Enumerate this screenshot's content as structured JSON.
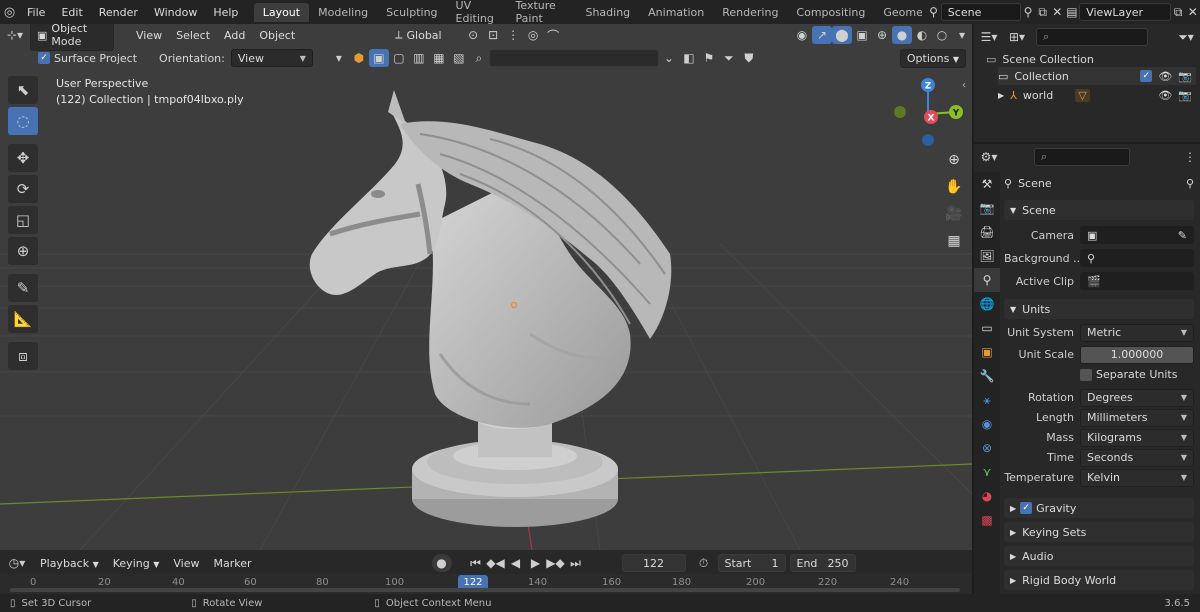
{
  "topbar": {
    "menus": [
      "File",
      "Edit",
      "Render",
      "Window",
      "Help"
    ],
    "workspaces": [
      "Layout",
      "Modeling",
      "Sculpting",
      "UV Editing",
      "Texture Paint",
      "Shading",
      "Animation",
      "Rendering",
      "Compositing",
      "Geometry Noc"
    ],
    "active_workspace": "Layout",
    "scene_name": "Scene",
    "view_layer": "ViewLayer"
  },
  "viewport_header": {
    "mode": "Object Mode",
    "menus": [
      "View",
      "Select",
      "Add",
      "Object"
    ],
    "orientation_global": "Global",
    "options_label": "Options"
  },
  "viewport_header2": {
    "surface_project": "Surface Project",
    "orientation_label": "Orientation:",
    "orientation_value": "View"
  },
  "viewport": {
    "view_name": "User Perspective",
    "object_info": "(122) Collection | tmpof04lbxo.ply"
  },
  "gizmo": {
    "z": "Z",
    "y": "Y",
    "x": "X"
  },
  "timeline": {
    "menus": [
      "Playback",
      "Keying",
      "View",
      "Marker"
    ],
    "current_frame": "122",
    "start_label": "Start",
    "start": "1",
    "end_label": "End",
    "end": "250",
    "ruler_ticks": [
      "0",
      "20",
      "40",
      "60",
      "80",
      "100",
      "122",
      "140",
      "160",
      "180",
      "200",
      "220",
      "240"
    ],
    "playhead": "122"
  },
  "statusbar": {
    "items": [
      "Set 3D Cursor",
      "Rotate View",
      "Object Context Menu"
    ],
    "version": "3.6.5"
  },
  "outliner": {
    "root": "Scene Collection",
    "collection": "Collection",
    "child": "world"
  },
  "properties": {
    "context": "Scene",
    "scene_panel": {
      "title": "Scene",
      "camera_label": "Camera",
      "background_label": "Background ...",
      "active_clip_label": "Active Clip"
    },
    "units_panel": {
      "title": "Units",
      "rows": [
        {
          "label": "Unit System",
          "value": "Metric"
        },
        {
          "label": "Unit Scale",
          "value": "1.000000"
        },
        {
          "label": "Rotation",
          "value": "Degrees"
        },
        {
          "label": "Length",
          "value": "Millimeters"
        },
        {
          "label": "Mass",
          "value": "Kilograms"
        },
        {
          "label": "Time",
          "value": "Seconds"
        },
        {
          "label": "Temperature",
          "value": "Kelvin"
        }
      ],
      "separate_units": "Separate Units"
    },
    "collapsed_panels": [
      "Gravity",
      "Keying Sets",
      "Audio",
      "Rigid Body World"
    ]
  },
  "colors": {
    "accent": "#4772b3",
    "viewport_bg": "#3d3d3d",
    "axis_x": "#e04c5a",
    "axis_y": "#8cbf26",
    "axis_z": "#3e84d8",
    "model": "#c4c4c4"
  }
}
